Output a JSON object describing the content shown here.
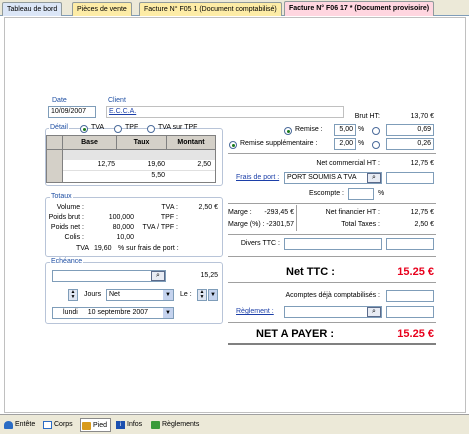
{
  "tabs": [
    {
      "label": "Tableau de bord"
    },
    {
      "label": "Pièces de vente"
    },
    {
      "label": "Facture N° F05 1 (Document comptabilisé)"
    },
    {
      "label": "Facture N° F06 17 * (Document provisoire)"
    }
  ],
  "header": {
    "date_label": "Date",
    "date_value": "10/09/2007",
    "client_label": "Client",
    "client_value": "E.C.C.A."
  },
  "detail": {
    "legend": "Détail",
    "radios": [
      "TVA",
      "TPF",
      "TVA sur TPF"
    ],
    "selected": "TVA",
    "columns": [
      "Base",
      "Taux",
      "Montant"
    ],
    "rows": [
      {
        "base": "12,75",
        "taux": "19,60",
        "montant": "2,50"
      },
      {
        "base": "",
        "taux": "5,50",
        "montant": ""
      }
    ]
  },
  "totaux": {
    "legend": "Totaux",
    "volume_label": "Volume :",
    "tva_label": "TVA :",
    "tva_value": "2,50 €",
    "poids_brut_label": "Poids brut :",
    "poids_brut_value": "100,000",
    "tpf_label": "TPF :",
    "poids_net_label": "Poids net :",
    "poids_net_value": "80,000",
    "tva_tpf_label": "TVA / TPF :",
    "colis_label": "Colis :",
    "colis_value": "10,00",
    "tva_frais_prefix": "TVA",
    "tva_frais_rate": "19,60",
    "tva_frais_suffix": "% sur frais de port :"
  },
  "echeance": {
    "legend": "Echéance",
    "amount": "15,25",
    "jours_label": "Jours",
    "jours_value": "Net",
    "le_label": "Le :",
    "date_day": "lundi",
    "date_value": "10 septembre 2007"
  },
  "right": {
    "brut_ht_label": "Brut HT:",
    "brut_ht_value": "13,70 €",
    "remise_label": "Remise :",
    "remise_pct": "5,00",
    "remise_amount": "0,69",
    "remise_supp_label": "Remise supplémentaire :",
    "remise_supp_pct": "2,00",
    "remise_supp_amount": "0,26",
    "pct_symbol": "%",
    "net_commercial_label": "Net commercial HT :",
    "net_commercial_value": "12,75 €",
    "frais_port_label": "Frais de port :",
    "frais_port_value": "PORT SOUMIS A TVA",
    "escompte_label": "Escompte :",
    "marge_label": "Marge :",
    "marge_value": "-293,45 €",
    "marge_pct_label": "Marge (%) :",
    "marge_pct_value": "-2301,57",
    "net_financier_label": "Net financier HT :",
    "net_financier_value": "12,75 €",
    "total_taxes_label": "Total Taxes :",
    "total_taxes_value": "2,50 €",
    "divers_ttc_label": "Divers TTC :",
    "net_ttc_label": "Net TTC :",
    "net_ttc_value": "15.25 €",
    "acomptes_label": "Acomptes déjà comptabilisés :",
    "reglement_label": "Règlement :",
    "net_payer_label": "NET A PAYER :",
    "net_payer_value": "15.25 €"
  },
  "bottom_bar": [
    {
      "label": "Entête"
    },
    {
      "label": "Corps"
    },
    {
      "label": "Pied"
    },
    {
      "label": "Infos"
    },
    {
      "label": "Règlements"
    }
  ],
  "colors": {
    "accent_red": "#e8001c",
    "link_blue": "#1c3fa8",
    "tab_active": "#ffd6e0",
    "tab_yellow": "#fdeca6"
  }
}
